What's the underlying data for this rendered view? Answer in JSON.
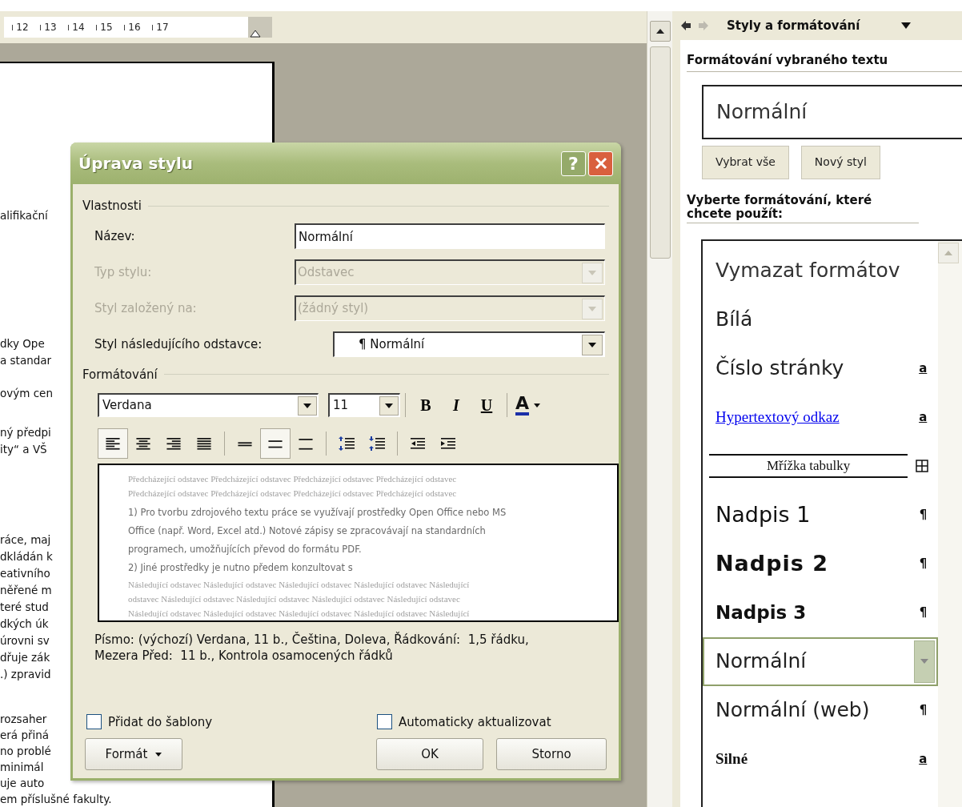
{
  "ruler": {
    "numbers": [
      "12",
      "13",
      "14",
      "15",
      "16",
      "17"
    ]
  },
  "document": {
    "paragraphs": [
      [
        "alifikační"
      ],
      [
        "dky Ope",
        "a standar"
      ],
      [
        "ovým cen"
      ],
      [
        "ný předpi",
        "ity“ a VŠ"
      ],
      [
        "ráce, maj",
        "dkládán k",
        "eativního",
        "něřené m",
        "teré stud",
        "dkých úk",
        "úrovni sv",
        "dřuje zák",
        ".) zpravid"
      ],
      [
        "rozsaher",
        "erá přiná",
        "no problé",
        "minimál",
        "uje auto",
        "em příslušné fakulty."
      ]
    ]
  },
  "dialog": {
    "title": "Úprava stylu",
    "help": "?",
    "properties": {
      "heading": "Vlastnosti",
      "fields": [
        {
          "label": "Název:",
          "value": "Normální",
          "kind": "text",
          "disabled": false
        },
        {
          "label": "Typ stylu:",
          "value": "Odstavec",
          "kind": "select",
          "disabled": true
        },
        {
          "label": "Styl založený na:",
          "value": "(žádný styl)",
          "kind": "select",
          "disabled": true
        },
        {
          "label": "Styl následujícího odstavce:",
          "value": "¶ Normální",
          "kind": "select",
          "disabled": false
        }
      ]
    },
    "formatting": {
      "heading": "Formátování",
      "font": "Verdana",
      "size": "11",
      "bold": "B",
      "italic": "I",
      "underline": "U",
      "font_color": "A",
      "alignment": [
        {
          "kind": "left",
          "selected": true
        },
        {
          "kind": "center",
          "selected": false
        },
        {
          "kind": "right",
          "selected": false
        },
        {
          "kind": "justify",
          "selected": false
        }
      ],
      "line_spacing": [
        {
          "kind": "single",
          "selected": false
        },
        {
          "kind": "one_half",
          "selected": true
        },
        {
          "kind": "double",
          "selected": false
        }
      ],
      "paragraph_spacing": [
        {
          "kind": "increase"
        },
        {
          "kind": "decrease"
        }
      ],
      "indent": [
        {
          "kind": "decrease"
        },
        {
          "kind": "increase"
        }
      ]
    },
    "preview": {
      "previous_lines": [
        "Předcházející odstavec Předcházející odstavec Předcházející odstavec Předcházející odstavec",
        "Předcházející odstavec Předcházející odstavec Předcházející odstavec Předcházející odstavec"
      ],
      "sample_lines": [
        "1) Pro tvorbu zdrojového textu práce se využívají prostředky Open Office nebo MS",
        "Office (např. Word, Excel atd.) Notové zápisy se zpracovávají na standardních",
        "programech, umožňujících převod do formátu PDF.",
        "2) Jiné prostředky je nutno předem konzultovat s"
      ],
      "following_lines": [
        "Následující odstavec Následující odstavec Následující odstavec Následující odstavec Následující",
        "odstavec Následující odstavec Následující odstavec Následující odstavec Následující odstavec",
        "Následující odstavec Následující odstavec Následující odstavec Následující odstavec Následující"
      ]
    },
    "description": "Písmo: (výchozí) Verdana, 11 b., Čeština, Doleva, Řádkování:  1,5 řádku, Mezera Před:  11 b., Kontrola osamocených řádků",
    "checkboxes": [
      {
        "label": "Přidat do šablony",
        "checked": false
      },
      {
        "label": "Automaticky aktualizovat",
        "checked": false
      }
    ],
    "buttons": [
      {
        "label": "Formát",
        "kind": "menu"
      },
      {
        "label": "OK",
        "kind": "plain"
      },
      {
        "label": "Storno",
        "kind": "plain"
      }
    ]
  },
  "task_pane": {
    "title": "Styly a formátování",
    "selected_heading": "Formátování vybraného textu",
    "current_style": "Normální",
    "buttons": [
      "Vybrat vše",
      "Nový styl"
    ],
    "list_heading": "Vyberte formátování, které chcete použít:",
    "styles": [
      {
        "label": "Vymazat formátov",
        "kind": "clear",
        "selected": false
      },
      {
        "label": "Bílá",
        "kind": "plain",
        "selected": false
      },
      {
        "label": "Číslo stránky",
        "kind": "plain",
        "mark": "a",
        "selected": false
      },
      {
        "label": "Hypertextový odkaz",
        "kind": "link",
        "mark": "a",
        "selected": false
      },
      {
        "label": "Mřížka tabulky",
        "kind": "table",
        "selected": false
      },
      {
        "label": "Nadpis 1",
        "kind": "heading1",
        "mark": "¶",
        "selected": false
      },
      {
        "label": "Nadpis 2",
        "kind": "heading2",
        "mark": "¶",
        "selected": false
      },
      {
        "label": "Nadpis 3",
        "kind": "heading3",
        "mark": "¶",
        "selected": false
      },
      {
        "label": "Normální",
        "kind": "plain",
        "selected": true
      },
      {
        "label": "Normální (web)",
        "kind": "plain",
        "mark": "¶",
        "selected": false
      },
      {
        "label": "Silné",
        "kind": "strong",
        "mark": "a",
        "selected": false
      }
    ]
  }
}
